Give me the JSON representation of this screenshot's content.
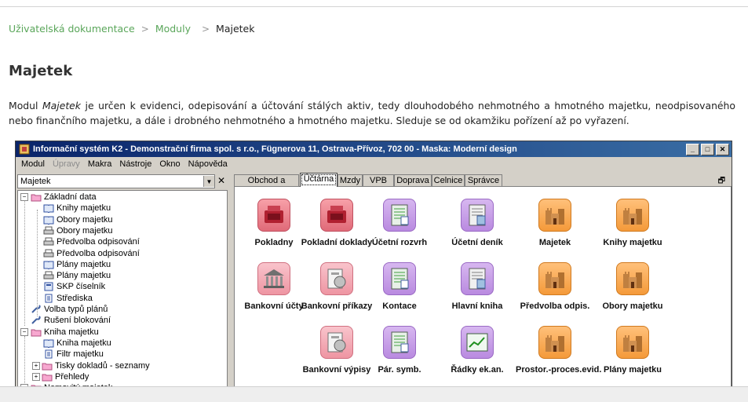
{
  "breadcrumb": {
    "item1": "Uživatelská dokumentace",
    "item2": "Moduly",
    "current": "Majetek"
  },
  "page_title": "Majetek",
  "intro": {
    "before": "Modul ",
    "module_name": "Majetek",
    "after": " je určen k evidenci, odepisování a účtování stálých aktiv, tedy dlouhodobého nehmotného a hmotného majetku, neodpisovaného nebo finančního majetku, a dále i drobného nehmotného a hmotného majetku. Sleduje se od okamžiku pořízení až po vyřazení."
  },
  "window": {
    "title": "Informační systém K2 - Demonstrační firma spol. s r.o., Fügnerova 11, Ostrava-Přívoz, 702 00 -  Maska: Moderní design",
    "menu": [
      "Modul",
      "Úpravy",
      "Makra",
      "Nástroje",
      "Okno",
      "Nápověda"
    ],
    "combo_value": "Majetek",
    "tree": [
      "Základní data",
      "Knihy majetku",
      "Obory majetku",
      "Obory majetku",
      "Předvolba odpisování",
      "Předvolba odpisování",
      "Plány majetku",
      "Plány majetku",
      "SKP číselník",
      "Střediska",
      "Volba typů plánů",
      "Rušení blokování",
      "Kniha majetku",
      "Kniha majetku",
      "Filtr majetku",
      "Tisky dokladů - seznamy",
      "Přehledy",
      "Nemovitý majetek"
    ],
    "tabs": [
      "Obchod a Výroba",
      "Účtárna",
      "Mzdy",
      "VPB",
      "Doprava",
      "Celnice",
      "Správce"
    ],
    "tiles": [
      "Pokladny",
      "Pokladní doklady",
      "Účetní rozvrh",
      "Účetní deník",
      "Majetek",
      "Knihy majetku",
      "Bankovní účty",
      "Bankovní příkazy",
      "Kontace",
      "Hlavní kniha",
      "Předvolba odpis.",
      "Obory majetku",
      "Bankovní výpisy",
      "Pár. symb.",
      "Řádky ek.an.",
      "Prostor.-proces.evid.",
      "Plány majetku"
    ]
  },
  "colors": {
    "link": "#5aa65a",
    "titlebar": "#0a246a"
  }
}
